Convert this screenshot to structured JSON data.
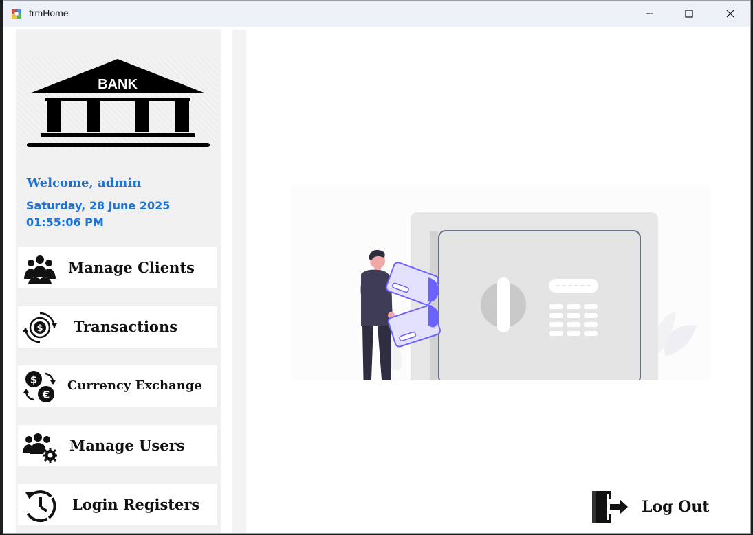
{
  "window": {
    "title": "frmHome",
    "minimize_label": "Minimize",
    "maximize_label": "Maximize",
    "close_label": "Close"
  },
  "sidebar": {
    "logo_text": "BANK",
    "welcome": "Welcome, admin",
    "date": "Saturday, 28 June 2025",
    "time": "01:55:06 PM",
    "menu": [
      {
        "label": "Manage Clients",
        "icon": "users-group-icon"
      },
      {
        "label": "Transactions",
        "icon": "dollar-cycle-icon"
      },
      {
        "label": "Currency Exchange",
        "icon": "currency-exchange-icon"
      },
      {
        "label": "Manage Users",
        "icon": "users-gear-icon"
      },
      {
        "label": "Login Registers",
        "icon": "history-clock-icon"
      }
    ]
  },
  "main": {
    "logout_label": "Log Out",
    "illustration": "person-at-safe-illustration"
  },
  "colors": {
    "accent": "#1a73d9",
    "titlebar": "#eef2f8",
    "card_accent": "#6c63ff"
  }
}
